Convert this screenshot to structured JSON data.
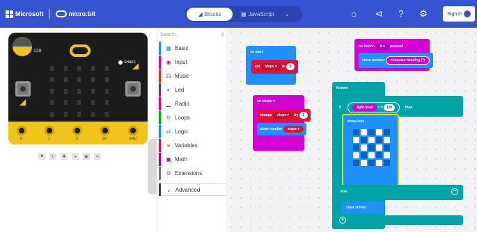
{
  "header": {
    "brand_microsoft": "Microsoft",
    "brand_microbit": "micro:bit",
    "tab_blocks": "Blocks",
    "tab_javascript": "JavaScript",
    "sign_in": "Sign In",
    "icons": [
      "home-icon",
      "share-icon",
      "help-icon",
      "gear-icon"
    ]
  },
  "simulator": {
    "light_value": "128",
    "shake_label": "SHAKE",
    "pins": [
      "0",
      "1",
      "2",
      "3V",
      "GND"
    ],
    "controls": [
      "stop-icon",
      "restart-icon",
      "slowmo-icon",
      "mute-icon",
      "screenshot-icon",
      "fullscreen-icon"
    ]
  },
  "toolbox": {
    "search_placeholder": "Search...",
    "categories": [
      {
        "label": "Basic",
        "color": "#1e90ff",
        "icon": "grid-icon"
      },
      {
        "label": "Input",
        "color": "#d400d4",
        "icon": "circle-icon"
      },
      {
        "label": "Music",
        "color": "#e63022",
        "icon": "headphones-icon"
      },
      {
        "label": "Led",
        "color": "#5c2d91",
        "icon": "toggle-icon"
      },
      {
        "label": "Radio",
        "color": "#e3008c",
        "icon": "signal-icon"
      },
      {
        "label": "Loops",
        "color": "#00aa00",
        "icon": "loop-icon"
      },
      {
        "label": "Logic",
        "color": "#00a4a6",
        "icon": "shuffle-icon"
      },
      {
        "label": "Variables",
        "color": "#dc143c",
        "icon": "list-icon"
      },
      {
        "label": "Math",
        "color": "#9400d3",
        "icon": "calculator-icon"
      },
      {
        "label": "Extensions",
        "color": "#777777",
        "icon": "gear-icon"
      }
    ],
    "advanced_label": "Advanced"
  },
  "workspace": {
    "on_start": {
      "header": "on start",
      "set": "set",
      "var": "steps",
      "to": "to",
      "value": "0"
    },
    "on_button": {
      "header": "on button",
      "button": "A",
      "event": "pressed",
      "show_number": "show number",
      "compass": "compass heading (°)"
    },
    "on_shake": {
      "header": "on shake",
      "change": "change",
      "var": "steps",
      "by": "by",
      "value": "1",
      "show_number": "show number",
      "show_var": "steps"
    },
    "forever": {
      "header": "forever",
      "if": "if",
      "light": "light level",
      "op": "<",
      "threshold": "100",
      "then": "then",
      "show_leds": "show leds",
      "else": "else",
      "clear": "clear screen",
      "leds": [
        [
          0,
          1,
          0,
          1,
          0
        ],
        [
          1,
          0,
          1,
          0,
          1
        ],
        [
          0,
          1,
          0,
          1,
          0
        ],
        [
          1,
          0,
          1,
          0,
          1
        ],
        [
          0,
          1,
          0,
          1,
          0
        ]
      ]
    }
  }
}
